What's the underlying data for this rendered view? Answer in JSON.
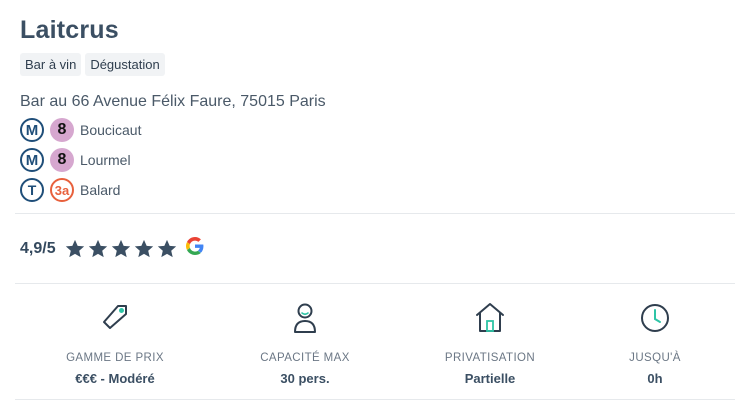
{
  "venue": {
    "name": "Laitcrus",
    "tags": [
      "Bar à vin",
      "Dégustation"
    ],
    "address": "Bar au 66 Avenue Félix Faure, 75015 Paris"
  },
  "transit": [
    {
      "mode": "M",
      "mode_icon": "metro-icon",
      "line": "8",
      "station": "Boucicaut"
    },
    {
      "mode": "M",
      "mode_icon": "metro-icon",
      "line": "8",
      "station": "Lourmel"
    },
    {
      "mode": "T",
      "mode_icon": "tram-icon",
      "line": "3a",
      "station": "Balard"
    }
  ],
  "rating": {
    "score": "4,9/5",
    "stars": 5,
    "source_icon": "google-icon"
  },
  "features": [
    {
      "icon": "price-tag-icon",
      "label": "GAMME DE PRIX",
      "value": "€€€ - Modéré"
    },
    {
      "icon": "person-icon",
      "label": "CAPACITÉ MAX",
      "value": "30 pers."
    },
    {
      "icon": "house-icon",
      "label": "PRIVATISATION",
      "value": "Partielle"
    },
    {
      "icon": "clock-icon",
      "label": "JUSQU'À",
      "value": "0h"
    }
  ],
  "colors": {
    "text_dark": "#3b4f63",
    "accent_teal": "#2ec4a6",
    "metro_blue": "#1f4e79",
    "line8": "#d6a7cf",
    "line3a": "#e8603c",
    "star": "#3b4f63"
  }
}
